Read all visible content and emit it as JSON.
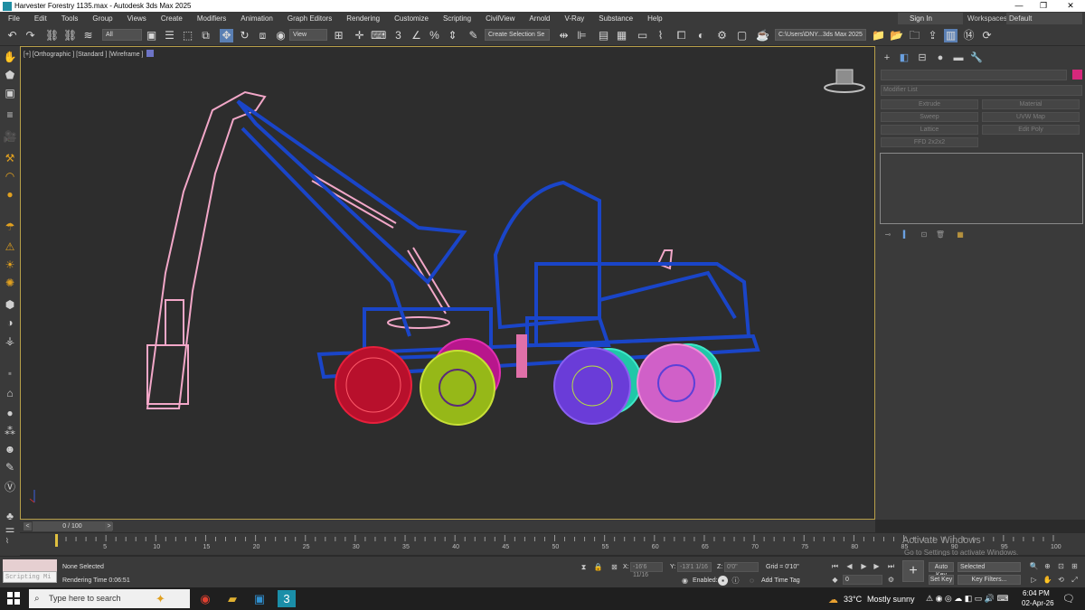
{
  "window": {
    "title": "Harvester Forestry 1135.max - Autodesk 3ds Max 2025",
    "minimize": "—",
    "maximize": "❐",
    "close": "✕"
  },
  "menu": {
    "items": [
      "File",
      "Edit",
      "Tools",
      "Group",
      "Views",
      "Create",
      "Modifiers",
      "Animation",
      "Graph Editors",
      "Rendering",
      "Customize",
      "Scripting",
      "CivilView",
      "Arnold",
      "V-Ray",
      "Substance",
      "Help"
    ],
    "sign_in": "Sign In",
    "workspaces_label": "Workspaces:",
    "workspaces_value": "Default"
  },
  "toolbar": {
    "filter_value": "All",
    "refcoord_value": "View",
    "selection_set": "Create Selection Se",
    "project_path": "C:\\Users\\DNY...3ds Max 2025"
  },
  "viewport": {
    "label": "[+] [Orthographic ] [Standard ] [Wireframe ]"
  },
  "command_panel": {
    "modifier_list": "Modifier List",
    "buttons": [
      "Extrude",
      "Material",
      "Sweep",
      "UVW Map",
      "Lattice",
      "Edit Poly",
      "FFD 2x2x2"
    ]
  },
  "timeline": {
    "frame_display": "0 / 100",
    "prev": "<",
    "next": ">",
    "ticks": [
      0,
      5,
      10,
      15,
      20,
      25,
      30,
      35,
      40,
      45,
      50,
      55,
      60,
      65,
      70,
      75,
      80,
      85,
      90,
      95,
      100
    ]
  },
  "status": {
    "scripting_label": "Scripting Mi",
    "selection": "None Selected",
    "rendering_time": "Rendering Time  0:06:51",
    "x_label": "X:",
    "x_value": "-16'6 11/16",
    "y_label": "Y:",
    "y_value": "-13'1 1/16",
    "z_label": "Z:",
    "z_value": "0'0\"",
    "grid": "Grid = 0'10\"",
    "enabled_label": "Enabled:",
    "add_time_tag": "Add Time Tag",
    "auto_key": "Auto Key",
    "selected": "Selected",
    "set_key": "Set Key",
    "key_filters": "Key Filters...",
    "frame_field": "0"
  },
  "watermark": {
    "line1": "Activate Windows",
    "line2": "Go to Settings to activate Windows."
  },
  "taskbar": {
    "search_placeholder": "Type here to search",
    "temperature": "33°C",
    "weather": "Mostly sunny",
    "time": "6:04 PM",
    "date": "02-Apr-26"
  }
}
